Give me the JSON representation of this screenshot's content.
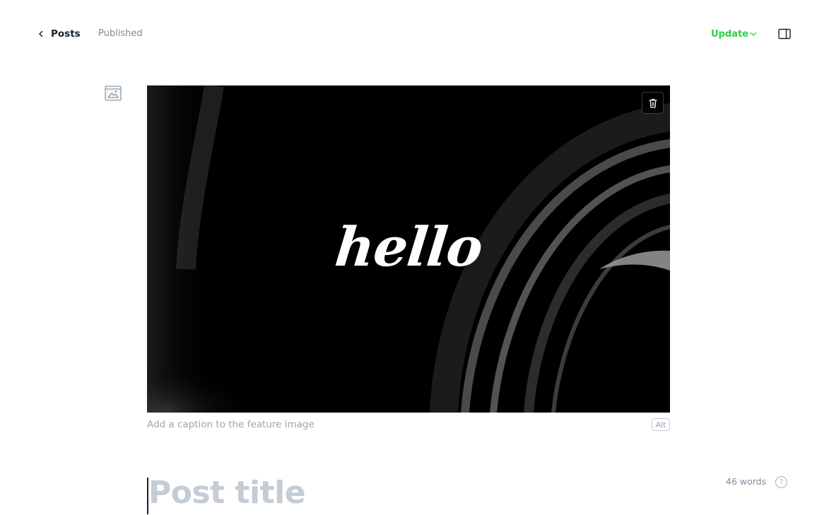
{
  "header": {
    "back_label": "Posts",
    "status": "Published",
    "update_label": "Update",
    "accent_color": "#30cf43"
  },
  "feature_image": {
    "overlay_text": "hello",
    "caption_placeholder": "Add a caption to the feature image",
    "alt_label": "Alt"
  },
  "editor": {
    "word_count": "46 words",
    "help_label": "?",
    "title_placeholder": "Post title"
  },
  "icons": {
    "back": "chevron-left-icon",
    "update": "chevron-down-icon",
    "sidebar": "sidebar-toggle-icon",
    "feature": "image-icon",
    "delete": "trash-icon"
  }
}
